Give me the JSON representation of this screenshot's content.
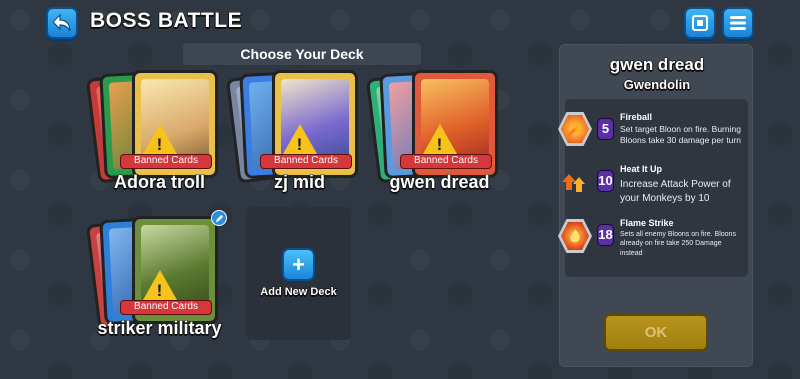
{
  "header": {
    "title": "BOSS BATTLE",
    "back_icon": "back-arrow-icon",
    "collection_icon": "card-collection-icon",
    "menu_icon": "hamburger-menu-icon"
  },
  "deck_section": {
    "title": "Choose Your Deck",
    "banned_label": "Banned Cards",
    "warning_glyph": "!",
    "decks": [
      {
        "name": "Adora troll",
        "colors": [
          "#c43a3a",
          "#2a9b4a",
          "#e8c04a"
        ]
      },
      {
        "name": "zj mid",
        "colors": [
          "#7a86a0",
          "#3b7de0",
          "#e8c04a"
        ]
      },
      {
        "name": "gwen dread",
        "colors": [
          "#2fae7a",
          "#5a9be0",
          "#e05a3a"
        ]
      },
      {
        "name": "striker military",
        "colors": [
          "#c94242",
          "#2d7fd8",
          "#6b8f3a"
        ]
      }
    ],
    "add_deck": {
      "plus": "+",
      "label": "Add New Deck"
    }
  },
  "detail": {
    "deck_name": "gwen dread",
    "hero": "Gwendolin",
    "abilities": [
      {
        "name": "Fireball",
        "cost": "5",
        "icon": "fireball-icon",
        "desc": "Set target Bloon on fire. Burning Bloons take 30 damage per turn"
      },
      {
        "name": "Heat It Up",
        "cost": "10",
        "icon": "heat-it-up-icon",
        "desc": "Increase Attack Power of your Monkeys by 10"
      },
      {
        "name": "Flame Strike",
        "cost": "18",
        "icon": "flame-strike-icon",
        "desc": "Sets all enemy Bloons on fire. Bloons already on fire take 250 Damage instead"
      }
    ],
    "ok_label": "OK"
  }
}
